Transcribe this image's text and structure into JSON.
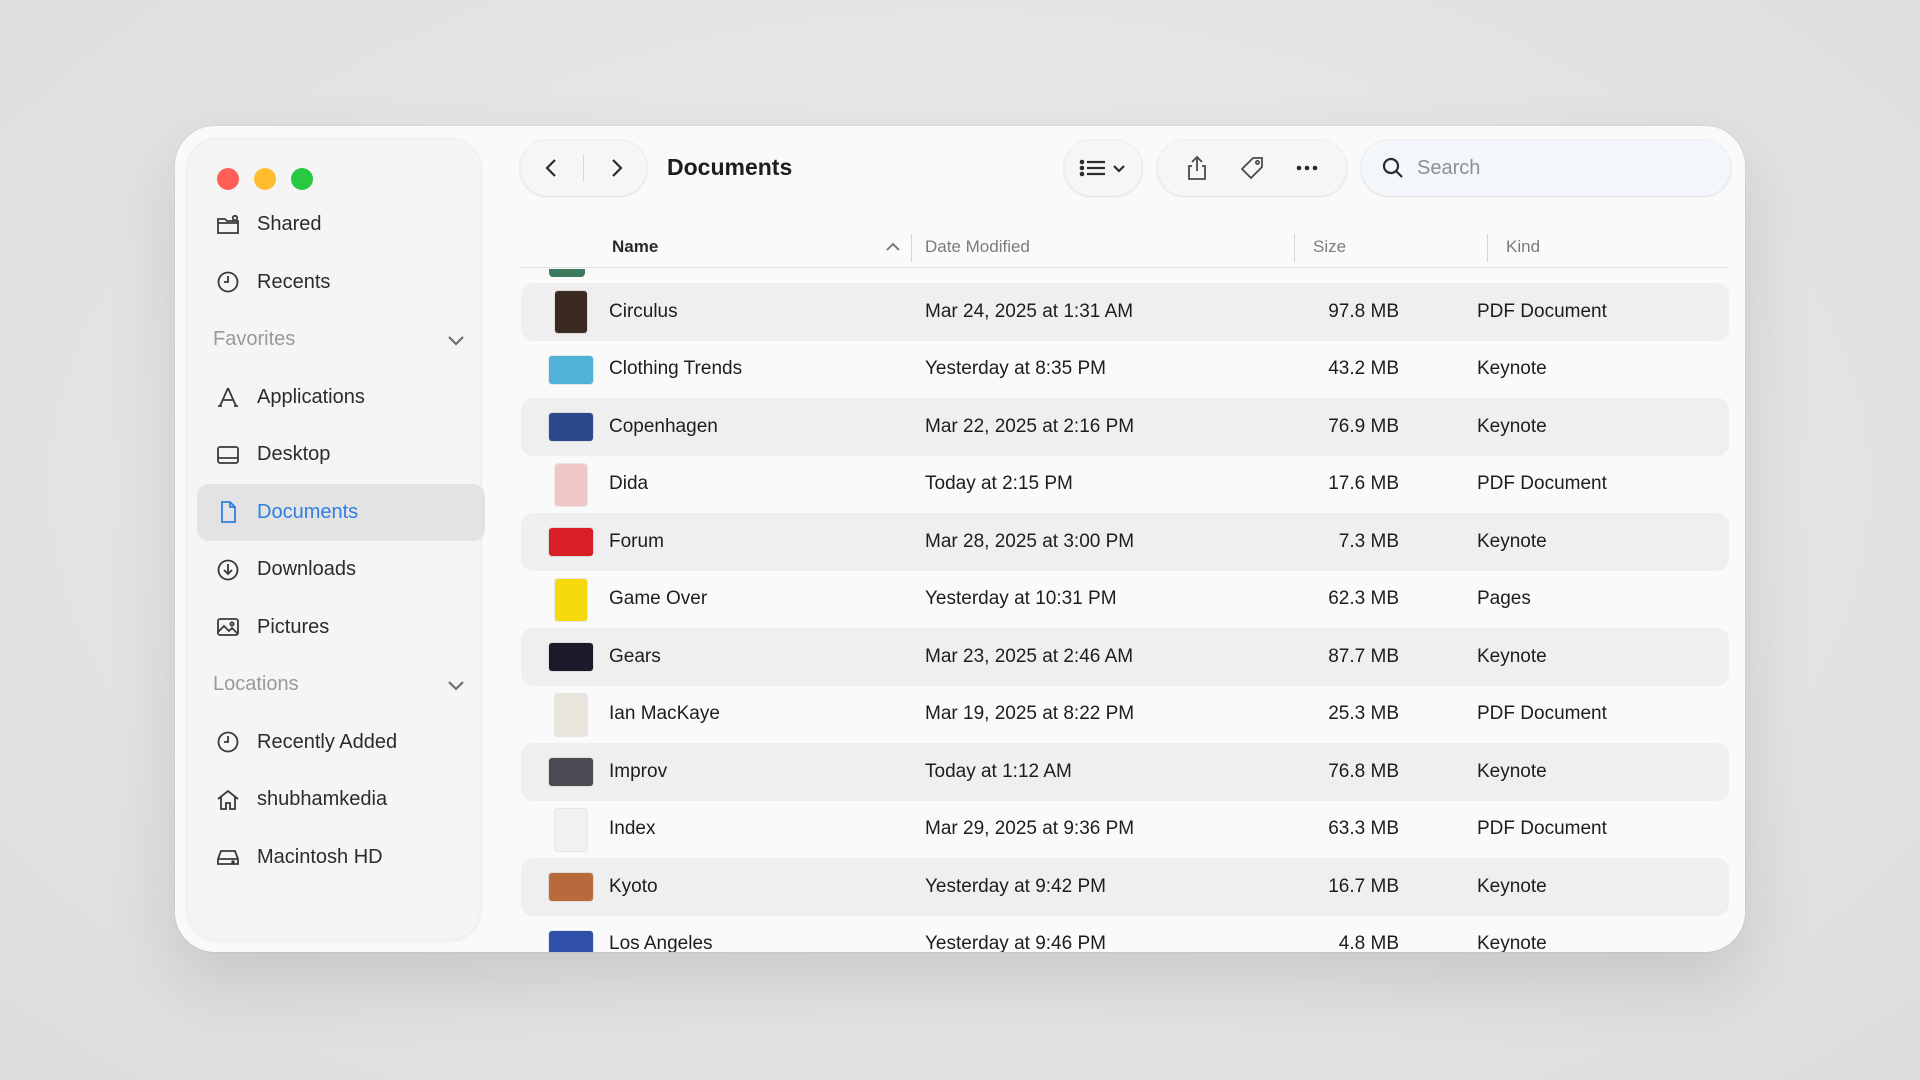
{
  "window": {
    "title": "Documents"
  },
  "sidebar": {
    "items_top": [
      {
        "label": "Shared",
        "icon": "shared-folder-icon"
      },
      {
        "label": "Recents",
        "icon": "clock-icon"
      }
    ],
    "favorites": {
      "header": "Favorites",
      "items": [
        {
          "label": "Applications",
          "icon": "applications-icon"
        },
        {
          "label": "Desktop",
          "icon": "desktop-icon"
        },
        {
          "label": "Documents",
          "icon": "document-icon",
          "active": true
        },
        {
          "label": "Downloads",
          "icon": "download-icon"
        },
        {
          "label": "Pictures",
          "icon": "photo-icon"
        }
      ]
    },
    "locations": {
      "header": "Locations",
      "items": [
        {
          "label": "Recently Added",
          "icon": "clock-icon"
        },
        {
          "label": "shubhamkedia",
          "icon": "home-icon"
        },
        {
          "label": "Macintosh HD",
          "icon": "drive-icon"
        }
      ]
    }
  },
  "toolbar": {
    "search_placeholder": "Search"
  },
  "columns": {
    "name": "Name",
    "date": "Date Modified",
    "size": "Size",
    "kind": "Kind"
  },
  "files": [
    {
      "name": "Circulus",
      "date": "Mar 24, 2025 at 1:31 AM",
      "size": "97.8 MB",
      "kind": "PDF Document",
      "thumb_color": "#3a2a22"
    },
    {
      "name": "Clothing Trends",
      "date": "Yesterday at 8:35 PM",
      "size": "43.2 MB",
      "kind": "Keynote",
      "thumb_color": "#4fb3d9"
    },
    {
      "name": "Copenhagen",
      "date": "Mar 22, 2025 at 2:16 PM",
      "size": "76.9 MB",
      "kind": "Keynote",
      "thumb_color": "#2b4a8c"
    },
    {
      "name": "Dida",
      "date": "Today at 2:15 PM",
      "size": "17.6 MB",
      "kind": "PDF Document",
      "thumb_color": "#f2c7c7"
    },
    {
      "name": "Forum",
      "date": "Mar 28, 2025 at 3:00 PM",
      "size": "7.3 MB",
      "kind": "Keynote",
      "thumb_color": "#d81f26"
    },
    {
      "name": "Game Over",
      "date": "Yesterday at 10:31 PM",
      "size": "62.3 MB",
      "kind": "Pages",
      "thumb_color": "#f5d90a"
    },
    {
      "name": "Gears",
      "date": "Mar 23, 2025 at 2:46 AM",
      "size": "87.7 MB",
      "kind": "Keynote",
      "thumb_color": "#1a1a2a"
    },
    {
      "name": "Ian MacKaye",
      "date": "Mar 19, 2025 at 8:22 PM",
      "size": "25.3 MB",
      "kind": "PDF Document",
      "thumb_color": "#e9e4dc"
    },
    {
      "name": "Improv",
      "date": "Today at 1:12 AM",
      "size": "76.8 MB",
      "kind": "Keynote",
      "thumb_color": "#4a4a52"
    },
    {
      "name": "Index",
      "date": "Mar 29, 2025 at 9:36 PM",
      "size": "63.3 MB",
      "kind": "PDF Document",
      "thumb_color": "#f1f1f1"
    },
    {
      "name": "Kyoto",
      "date": "Yesterday at 9:42 PM",
      "size": "16.7 MB",
      "kind": "Keynote",
      "thumb_color": "#b86a3c"
    },
    {
      "name": "Los Angeles",
      "date": "Yesterday at 9:46 PM",
      "size": "4.8 MB",
      "kind": "Keynote",
      "thumb_color": "#2f4fa8"
    }
  ],
  "colors": {
    "accent": "#2f7fe0",
    "close": "#ff5f57",
    "minimize": "#febc2e",
    "maximize": "#28c840"
  }
}
